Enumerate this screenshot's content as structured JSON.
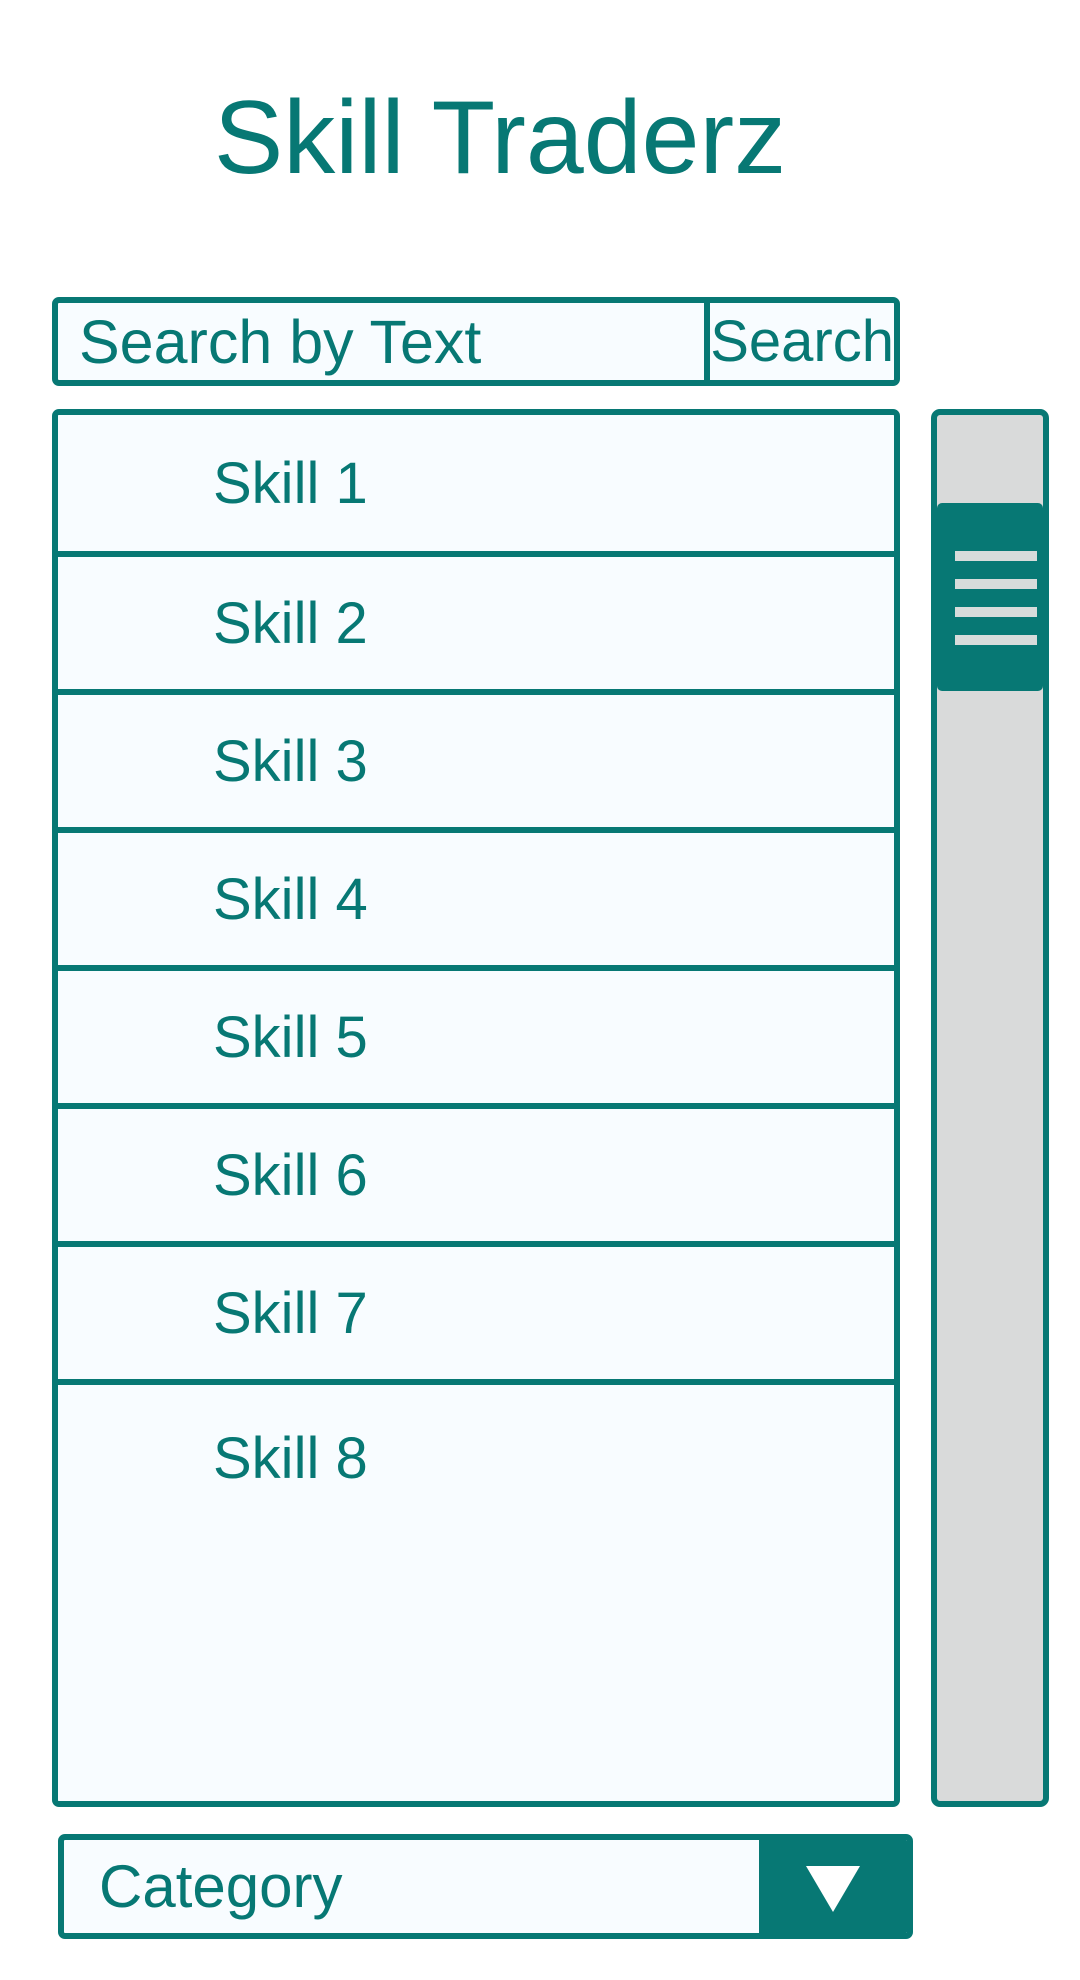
{
  "app": {
    "title": "Skill Traderz"
  },
  "search": {
    "placeholder": "Search by Text",
    "button_label": "Search"
  },
  "skills": [
    {
      "label": "Skill 1"
    },
    {
      "label": "Skill 2"
    },
    {
      "label": "Skill 3"
    },
    {
      "label": "Skill 4"
    },
    {
      "label": "Skill 5"
    },
    {
      "label": "Skill 6"
    },
    {
      "label": "Skill 7"
    },
    {
      "label": "Skill 8"
    }
  ],
  "scrollbar": {
    "grip_icon": "grip-lines-icon"
  },
  "category": {
    "label": "Category",
    "arrow_icon": "triangle-down-icon"
  },
  "colors": {
    "accent": "#077874",
    "surface": "#f8fcff",
    "track": "#d9dada",
    "grip": "#d7dcdb"
  }
}
